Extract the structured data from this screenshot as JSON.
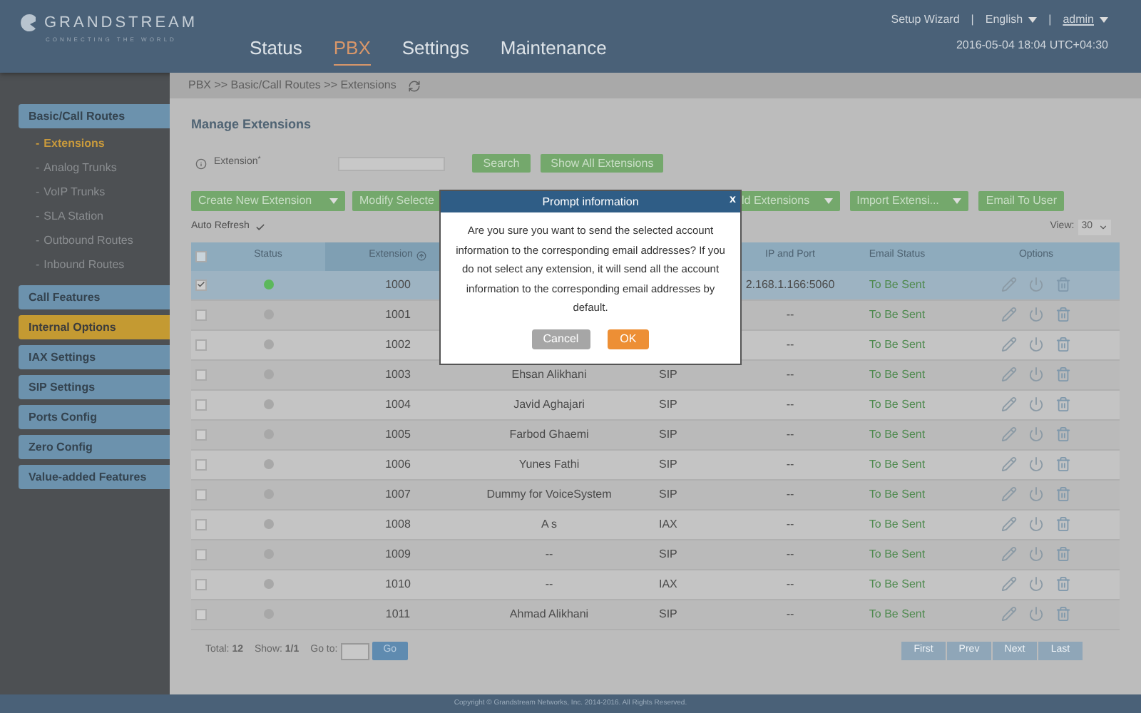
{
  "header": {
    "logo_name": "GRANDSTREAM",
    "logo_tagline": "CONNECTING THE WORLD",
    "nav": [
      {
        "label": "Status",
        "selected": false
      },
      {
        "label": "PBX",
        "selected": true
      },
      {
        "label": "Settings",
        "selected": false
      },
      {
        "label": "Maintenance",
        "selected": false
      }
    ],
    "setup_wizard": "Setup Wizard",
    "separator_1": "|",
    "language": "English",
    "separator_2": "|",
    "user": "admin",
    "datetime": "2016-05-04 18:04 UTC+04:30"
  },
  "breadcrumb": "PBX >> Basic/Call Routes >> Extensions",
  "sidebar": [
    {
      "label": "Basic/Call Routes",
      "highlighted": false,
      "children": [
        {
          "marker": "-",
          "label": "Extensions",
          "selected": true
        },
        {
          "marker": "-",
          "label": "Analog Trunks",
          "selected": false
        },
        {
          "marker": "-",
          "label": "VoIP Trunks",
          "selected": false
        },
        {
          "marker": "-",
          "label": "SLA Station",
          "selected": false
        },
        {
          "marker": "-",
          "label": "Outbound Routes",
          "selected": false
        },
        {
          "marker": "-",
          "label": "Inbound Routes",
          "selected": false
        }
      ]
    },
    {
      "label": "Call Features",
      "highlighted": false
    },
    {
      "label": "Internal Options",
      "highlighted": true
    },
    {
      "label": "IAX Settings",
      "highlighted": false
    },
    {
      "label": "SIP Settings",
      "highlighted": false
    },
    {
      "label": "Ports Config",
      "highlighted": false
    },
    {
      "label": "Zero Config",
      "highlighted": false
    },
    {
      "label": "Value-added Features",
      "highlighted": false
    }
  ],
  "page_title": "Manage Extensions",
  "search": {
    "label": "Extension",
    "required_mark": "*",
    "button": "Search",
    "show_all": "Show All Extensions"
  },
  "actions": [
    {
      "label": "Create New Extension",
      "dropdown": true
    },
    {
      "label": "Modify Selecte",
      "dropdown": false
    },
    {
      "label": "ld Extensions",
      "dropdown": true
    },
    {
      "label": "Import Extensi...",
      "dropdown": true
    },
    {
      "label": "Email To User",
      "dropdown": false
    }
  ],
  "auto_refresh": {
    "label": "Auto Refresh",
    "checked": true
  },
  "view": {
    "label": "View:",
    "value": "30"
  },
  "table": {
    "columns": {
      "status": "Status",
      "extension": "Extension",
      "ip_and_port": "IP and Port",
      "email_status": "Email Status",
      "options": "Options"
    },
    "all_checked": false,
    "rows": [
      {
        "checked": true,
        "selected": true,
        "color": "#5cb85c",
        "extension": "1000",
        "ip": "2.168.1.166:5060",
        "email_status": "To Be Sent"
      },
      {
        "checked": false,
        "selected": false,
        "color": "#a8a8a8",
        "extension": "1001",
        "ip": "--",
        "email_status": "To Be Sent"
      },
      {
        "checked": false,
        "selected": false,
        "color": "#a8a8a8",
        "extension": "1002",
        "ip": "--",
        "email_status": "To Be Sent"
      },
      {
        "checked": false,
        "selected": false,
        "color": "#a8a8a8",
        "extension": "1003",
        "name": "Ehsan Alikhani",
        "type": "SIP",
        "ip": "--",
        "email_status": "To Be Sent"
      },
      {
        "checked": false,
        "selected": false,
        "color": "#a8a8a8",
        "extension": "1004",
        "name": "Javid Aghajari",
        "type": "SIP",
        "ip": "--",
        "email_status": "To Be Sent"
      },
      {
        "checked": false,
        "selected": false,
        "color": "#a8a8a8",
        "extension": "1005",
        "name": "Farbod Ghaemi",
        "type": "SIP",
        "ip": "--",
        "email_status": "To Be Sent"
      },
      {
        "checked": false,
        "selected": false,
        "color": "#a8a8a8",
        "extension": "1006",
        "name": "Yunes Fathi",
        "type": "SIP",
        "ip": "--",
        "email_status": "To Be Sent"
      },
      {
        "checked": false,
        "selected": false,
        "color": "#a8a8a8",
        "extension": "1007",
        "name": "Dummy for VoiceSystem",
        "type": "SIP",
        "ip": "--",
        "email_status": "To Be Sent"
      },
      {
        "checked": false,
        "selected": false,
        "color": "#a8a8a8",
        "extension": "1008",
        "name": "A s",
        "type": "IAX",
        "ip": "--",
        "email_status": "To Be Sent"
      },
      {
        "checked": false,
        "selected": false,
        "color": "#a8a8a8",
        "extension": "1009",
        "name": "--",
        "type": "SIP",
        "ip": "--",
        "email_status": "To Be Sent"
      },
      {
        "checked": false,
        "selected": false,
        "color": "#a8a8a8",
        "extension": "1010",
        "name": "--",
        "type": "IAX",
        "ip": "--",
        "email_status": "To Be Sent"
      },
      {
        "checked": false,
        "selected": false,
        "color": "#a8a8a8",
        "extension": "1011",
        "name": "Ahmad Alikhani",
        "type": "SIP",
        "ip": "--",
        "email_status": "To Be Sent"
      }
    ]
  },
  "pager": {
    "total_label": "Total:",
    "total": "12",
    "show_label": "Show:",
    "show": "1/1",
    "goto_label": "Go to:",
    "go": "Go",
    "buttons": [
      "First",
      "Prev",
      "Next",
      "Last"
    ]
  },
  "modal": {
    "title": "Prompt information",
    "close": "x",
    "message": "Are you sure you want to send the selected account information to the corresponding email addresses? If you do not select any extension, it will send all the account information to the corresponding email addresses by default.",
    "cancel": "Cancel",
    "ok": "OK"
  },
  "footer": "Copyright © Grandstream Networks, Inc. 2014-2016. All Rights Reserved."
}
